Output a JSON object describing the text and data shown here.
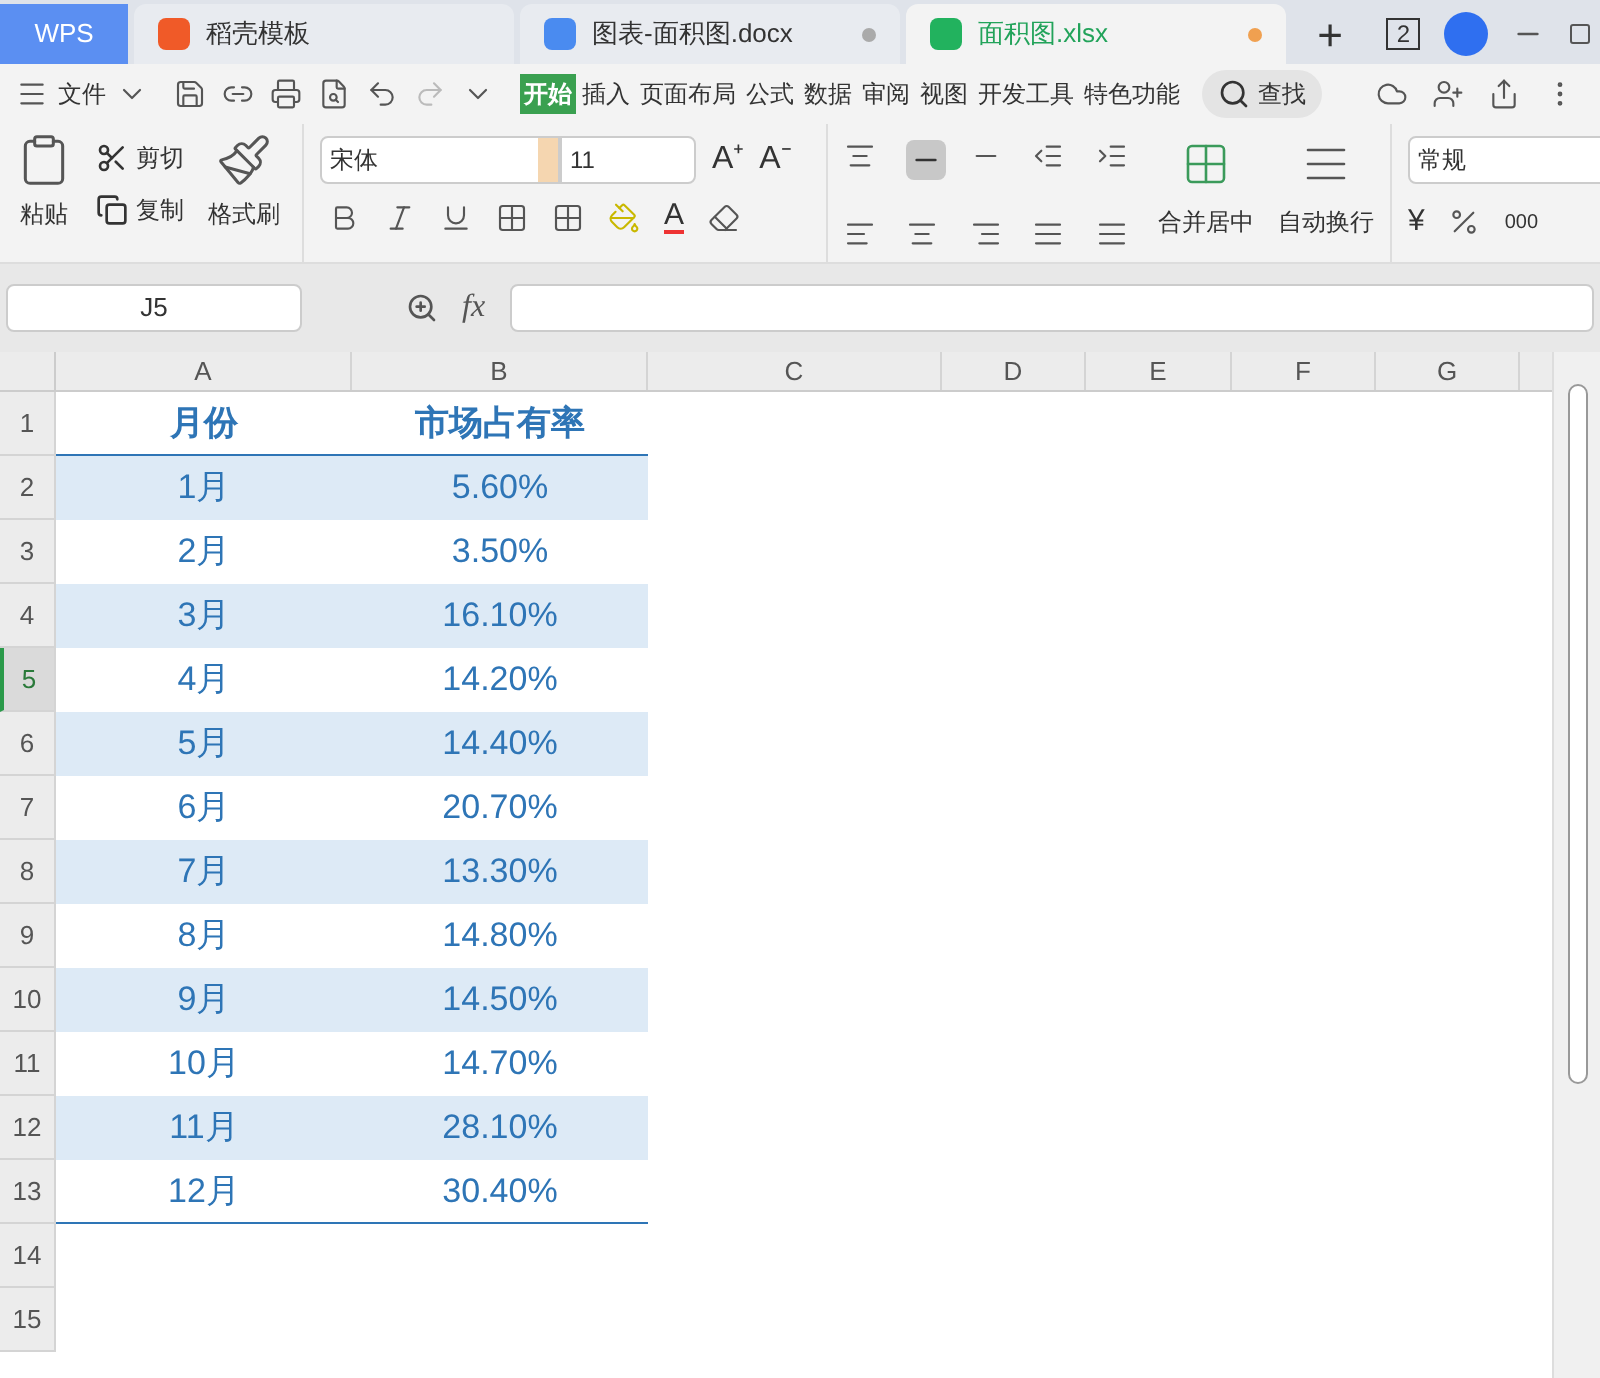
{
  "app_button": "WPS",
  "tabs": [
    {
      "kind": "template",
      "label": "稻壳模板",
      "selected": false,
      "unsaved": false
    },
    {
      "kind": "doc",
      "label": "图表-面积图.docx",
      "selected": false,
      "unsaved": true
    },
    {
      "kind": "sheet",
      "label": "面积图.xlsx",
      "selected": true,
      "unsaved": true
    }
  ],
  "new_tab": "+",
  "window_count": "2",
  "file_menu": "文件",
  "ribbon_tabs": [
    {
      "label": "开始",
      "selected": true
    },
    {
      "label": "插入",
      "selected": false
    },
    {
      "label": "页面布局",
      "selected": false
    },
    {
      "label": "公式",
      "selected": false
    },
    {
      "label": "数据",
      "selected": false
    },
    {
      "label": "审阅",
      "selected": false
    },
    {
      "label": "视图",
      "selected": false
    },
    {
      "label": "开发工具",
      "selected": false
    },
    {
      "label": "特色功能",
      "selected": false
    }
  ],
  "search": "查找",
  "clipboard": {
    "paste": "粘贴",
    "cut": "剪切",
    "copy": "复制",
    "format_painter": "格式刷"
  },
  "font": {
    "name": "宋体",
    "size": "11"
  },
  "alignment": {
    "merge": "合并居中",
    "wrap": "自动换行"
  },
  "number_format": "常规",
  "glyphs": {
    "grow_font": "A⁺",
    "shrink_font": "A⁻",
    "font_color": "A",
    "currency": "¥",
    "thousands": "000",
    "function": "fx"
  },
  "name_box": "J5",
  "columns": [
    "A",
    "B",
    "C",
    "D",
    "E",
    "F",
    "G"
  ],
  "rows": [
    {
      "label": "1",
      "selected": false,
      "cells": [
        "月份",
        "市场占有率"
      ]
    },
    {
      "label": "2",
      "selected": false,
      "cells": [
        "1月",
        "5.60%"
      ]
    },
    {
      "label": "3",
      "selected": false,
      "cells": [
        "2月",
        "3.50%"
      ]
    },
    {
      "label": "4",
      "selected": false,
      "cells": [
        "3月",
        "16.10%"
      ]
    },
    {
      "label": "5",
      "selected": true,
      "cells": [
        "4月",
        "14.20%"
      ]
    },
    {
      "label": "6",
      "selected": false,
      "cells": [
        "5月",
        "14.40%"
      ]
    },
    {
      "label": "7",
      "selected": false,
      "cells": [
        "6月",
        "20.70%"
      ]
    },
    {
      "label": "8",
      "selected": false,
      "cells": [
        "7月",
        "13.30%"
      ]
    },
    {
      "label": "9",
      "selected": false,
      "cells": [
        "8月",
        "14.80%"
      ]
    },
    {
      "label": "10",
      "selected": false,
      "cells": [
        "9月",
        "14.50%"
      ]
    },
    {
      "label": "11",
      "selected": false,
      "cells": [
        "10月",
        "14.70%"
      ]
    },
    {
      "label": "12",
      "selected": false,
      "cells": [
        "11月",
        "28.10%"
      ]
    },
    {
      "label": "13",
      "selected": false,
      "cells": [
        "12月",
        "30.40%"
      ]
    },
    {
      "label": "14",
      "selected": false,
      "cells": []
    },
    {
      "label": "15",
      "selected": false,
      "cells": []
    }
  ]
}
